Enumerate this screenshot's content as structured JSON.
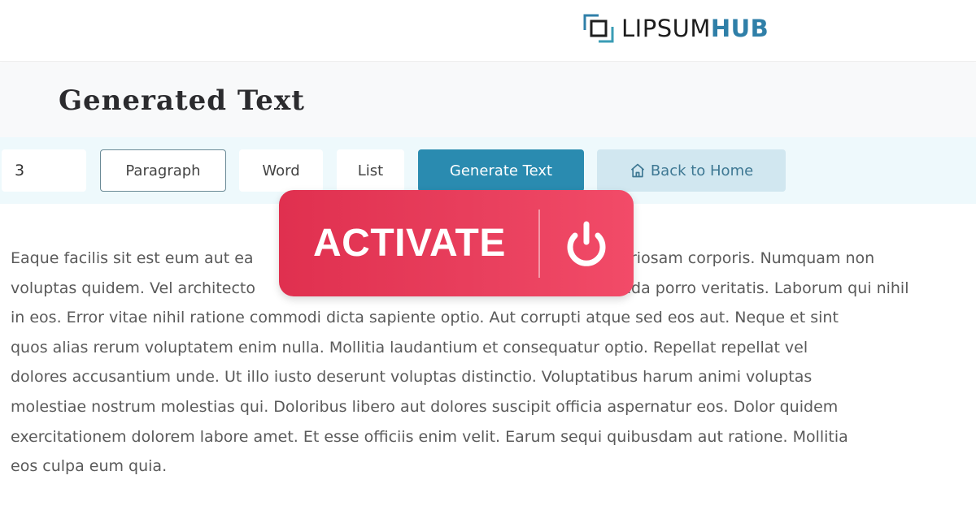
{
  "brand": {
    "name_part1": "LIPSUM",
    "name_part2": "HUB",
    "logo_icon": "nested-squares-logo-icon",
    "colors": {
      "dark": "#1e1e1e",
      "accent": "#2f7fa8"
    }
  },
  "header": {
    "title": "Generated Text"
  },
  "toolbar": {
    "quantity_value": "3",
    "paragraph_label": "Paragraph",
    "word_label": "Word",
    "list_label": "List",
    "generate_label": "Generate Text",
    "home_label": "Back to Home",
    "home_icon": "home-icon",
    "selected_mode": "Paragraph",
    "colors": {
      "generate_bg": "#2a8bb0",
      "home_bg": "#d1e7f0"
    }
  },
  "content": {
    "lines": [
      "Eaque facilis sit est eum aut ea",
      "voluptas quidem. Vel architecto",
      "in eos. Error vitae nihil ratione commodi dicta sapiente optio. Aut corrupti atque sed eos aut. Neque et sint",
      "quos alias rerum voluptatem enim nulla. Mollitia laudantium et consequatur optio. Repellat repellat vel",
      "dolores accusantium unde. Ut illo iusto deserunt voluptas distinctio. Voluptatibus harum animi voluptas",
      "molestiae nostrum molestias qui. Doloribus libero aut dolores suscipit officia aspernatur eos. Dolor quidem",
      "exercitationem dolorem labore amet. Et esse officiis enim velit. Earum sequi quibusdam aut ratione. Mollitia",
      "eos culpa eum quia."
    ],
    "line1_right": "riosam corporis. Numquam non",
    "line2_right": "nda porro veritatis. Laborum qui nihil"
  },
  "overlay": {
    "label": "ACTIVATE",
    "icon": "power-icon",
    "colors": {
      "start": "#e0304f",
      "end": "#f24b68"
    }
  }
}
